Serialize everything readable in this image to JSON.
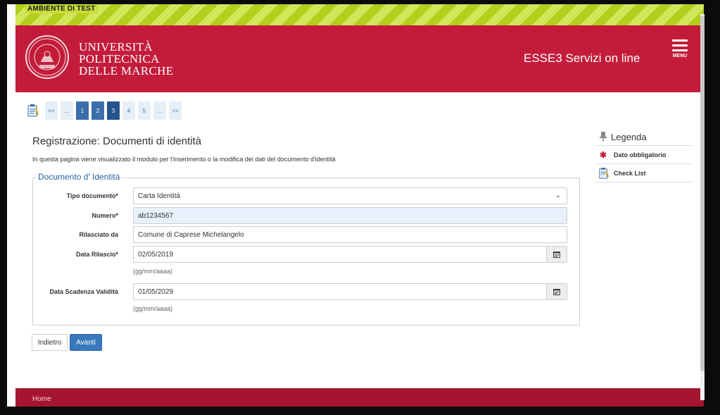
{
  "test_banner": "AMBIENTE DI TEST",
  "header": {
    "university_lines": [
      "UNIVERSITÀ",
      "POLITECNICA",
      "DELLE MARCHE"
    ],
    "site_title": "ESSE3 Servizi on line",
    "menu_label": "MENU",
    "brand_color": "#c31c3a"
  },
  "pager": {
    "first": "<<",
    "ellipsis_left": "...",
    "pages": [
      "1",
      "2",
      "3",
      "4",
      "5"
    ],
    "current": "3",
    "ellipsis_right": "...",
    "last": ">>"
  },
  "page": {
    "title": "Registrazione: Documenti di identità",
    "description": "In questa pagina viene visualizzato il modulo per l'inserimento o la modifica dei dati del documento d'identità"
  },
  "form": {
    "legend": "Documento d' Identità",
    "tipo_label": "Tipo documento*",
    "tipo_value": "Carta Identità",
    "numero_label": "Numero*",
    "numero_value": "ab1234567",
    "rilasciato_label": "Rilasciato da",
    "rilasciato_value": "Comune di Caprese Michelangelo",
    "data_rilascio_label": "Data Rilascio*",
    "data_rilascio_value": "02/05/2019",
    "data_rilascio_hint": "(gg/mm/aaaa)",
    "data_scadenza_label": "Data Scadenza Validità",
    "data_scadenza_value": "01/05/2029",
    "data_scadenza_hint": "(gg/mm/aaaa)"
  },
  "buttons": {
    "back": "Indietro",
    "next": "Avanti"
  },
  "legend_panel": {
    "title": "Legenda",
    "required": "Dato obbligatorio",
    "checklist": "Check List"
  },
  "footer": {
    "home": "Home"
  }
}
